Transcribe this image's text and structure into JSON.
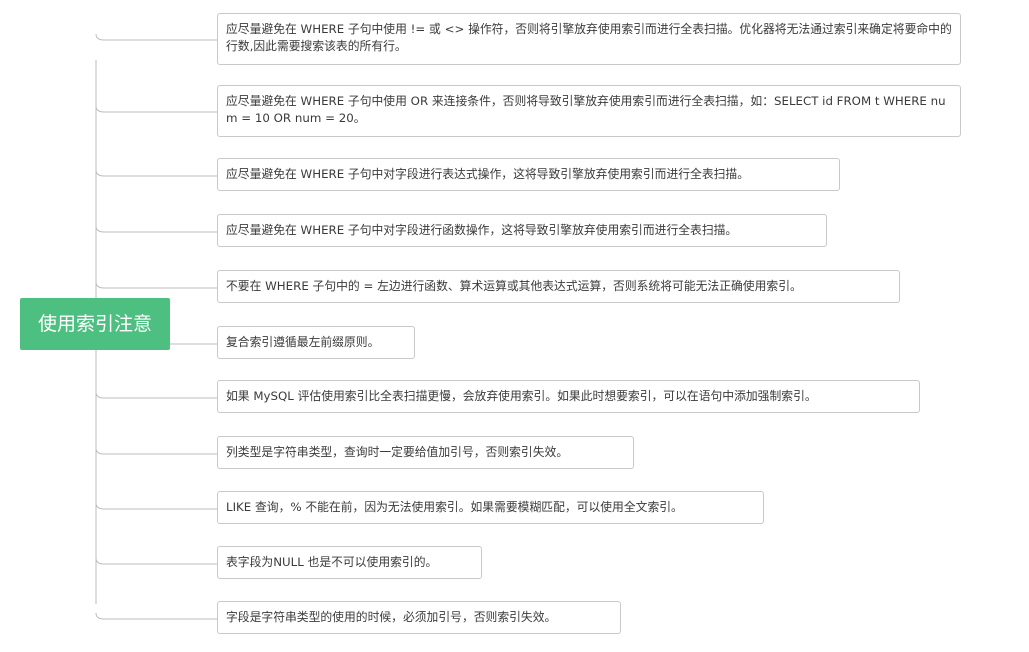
{
  "root": {
    "label": "使用索引注意"
  },
  "nodes": [
    "应尽量避免在 WHERE 子句中使用 != 或 <> 操作符，否则将引擎放弃使用索引而进行全表扫描。优化器将无法通过索引来确定将要命中的行数,因此需要搜索该表的所有行。",
    "应尽量避免在 WHERE 子句中使用 OR 来连接条件，否则将导致引擎放弃使用索引而进行全表扫描，如：SELECT id FROM t WHERE num = 10 OR num = 20。",
    "应尽量避免在 WHERE 子句中对字段进行表达式操作，这将导致引擎放弃使用索引而进行全表扫描。",
    "应尽量避免在 WHERE 子句中对字段进行函数操作，这将导致引擎放弃使用索引而进行全表扫描。",
    "不要在 WHERE 子句中的 = 左边进行函数、算术运算或其他表达式运算，否则系统将可能无法正确使用索引。",
    "复合索引遵循最左前缀原则。",
    "如果 MySQL 评估使用索引比全表扫描更慢，会放弃使用索引。如果此时想要索引，可以在语句中添加强制索引。",
    "列类型是字符串类型，查询时一定要给值加引号，否则索引失效。",
    "LIKE 查询，% 不能在前，因为无法使用索引。如果需要模糊匹配，可以使用全文索引。",
    "表字段为NULL 也是不可以使用索引的。",
    "字段是字符串类型的使用的时候，必须加引号，否则索引失效。"
  ]
}
